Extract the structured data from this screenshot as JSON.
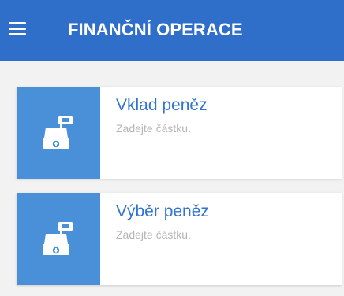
{
  "header": {
    "title": "FINANČNÍ OPERACE",
    "menu_icon": "hamburger-menu-icon"
  },
  "operations": [
    {
      "title": "Vklad peněz",
      "subtitle": "Zadejte částku.",
      "icon": "cash-register-arrow-up-icon"
    },
    {
      "title": "Výběr peněz",
      "subtitle": "Zadejte částku.",
      "icon": "cash-register-arrow-down-icon"
    }
  ],
  "colors": {
    "appbar": "#2f6fca",
    "icon_tile": "#4a90d9",
    "title_text": "#3173d2",
    "subtitle_text": "#b5b5b5"
  }
}
